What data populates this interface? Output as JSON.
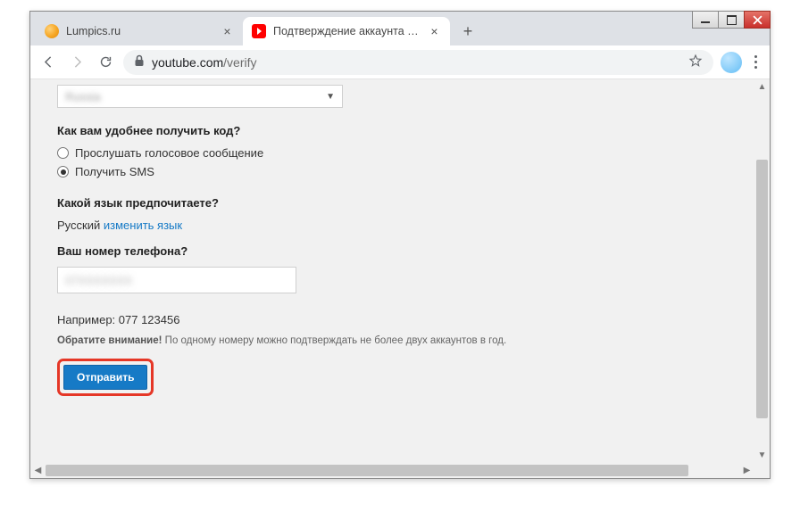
{
  "window": {
    "tabs": [
      {
        "title": "Lumpics.ru",
        "active": false
      },
      {
        "title": "Подтверждение аккаунта - You",
        "active": true
      }
    ]
  },
  "address": {
    "domain": "youtube.com",
    "path": "/verify"
  },
  "page": {
    "country_value": "Russia",
    "q1": "Как вам удобнее получить код?",
    "radio_voice": "Прослушать голосовое сообщение",
    "radio_sms": "Получить SMS",
    "q2": "Какой язык предпочитаете?",
    "lang_value": "Русский",
    "lang_change": "изменить язык",
    "q3": "Ваш номер телефона?",
    "phone_value": "07XXXXXXX",
    "example": "Например: 077 123456",
    "notice_bold": "Обратите внимание!",
    "notice_rest": " По одному номеру можно подтверждать не более двух аккаунтов в год.",
    "submit": "Отправить"
  }
}
